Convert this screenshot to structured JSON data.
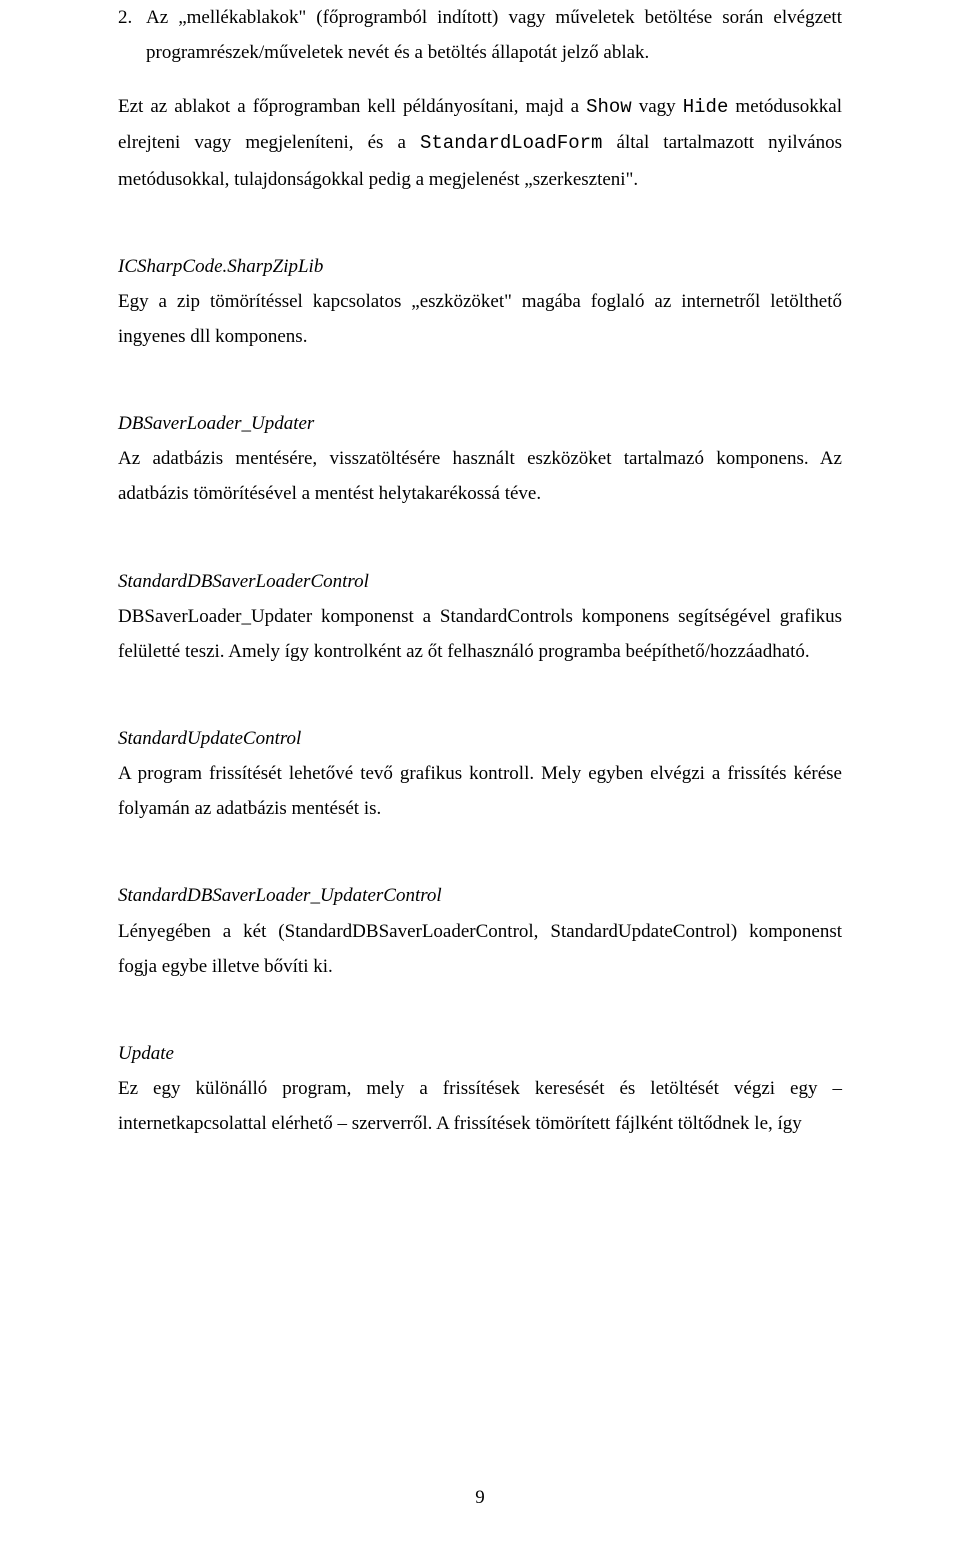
{
  "listItem": {
    "marker": "2.",
    "text": "Az „mellékablakok\" (főprogramból indított) vagy műveletek betöltése során elvégzett programrészek/műveletek nevét és a betöltés állapotát jelző ablak."
  },
  "intro": {
    "p1a": "Ezt az ablakot a főprogramban kell példányosítani, majd a ",
    "code1": "Show",
    "p1b": " vagy ",
    "code2": "Hide",
    "p1c": " metódusokkal elrejteni vagy megjeleníteni, és a ",
    "code3": "StandardLoadForm",
    "p1d": " által tartalmazott nyilvános metódusokkal, tulajdonságokkal pedig a megjelenést „szerkeszteni\"."
  },
  "sections": {
    "s1": {
      "title": "ICSharpCode.SharpZipLib",
      "body": "Egy a zip tömörítéssel kapcsolatos „eszközöket\" magába foglaló az internetről letölthető ingyenes dll komponens."
    },
    "s2": {
      "title": "DBSaverLoader_Updater",
      "body": "Az adatbázis mentésére, visszatöltésére használt eszközöket tartalmazó komponens. Az adatbázis tömörítésével a mentést helytakarékossá téve."
    },
    "s3": {
      "title": "StandardDBSaverLoaderControl",
      "body": "DBSaverLoader_Updater komponenst a StandardControls komponens segítségével grafikus felületté teszi. Amely így kontrolként az őt felhasználó programba beépíthető/hozzáadható."
    },
    "s4": {
      "title": "StandardUpdateControl",
      "body": "A program frissítését lehetővé tevő grafikus kontroll. Mely egyben elvégzi a frissítés kérése folyamán az adatbázis mentését is."
    },
    "s5": {
      "title": "StandardDBSaverLoader_UpdaterControl",
      "body": "Lényegében a két (StandardDBSaverLoaderControl, StandardUpdateControl) komponenst fogja egybe illetve bővíti ki."
    },
    "s6": {
      "title": "Update",
      "body": "Ez egy különálló program, mely a frissítések keresését és letöltését végzi egy – internetkapcsolattal elérhető – szerverről. A frissítések tömörített fájlként töltődnek le, így"
    }
  },
  "pageNumber": "9"
}
